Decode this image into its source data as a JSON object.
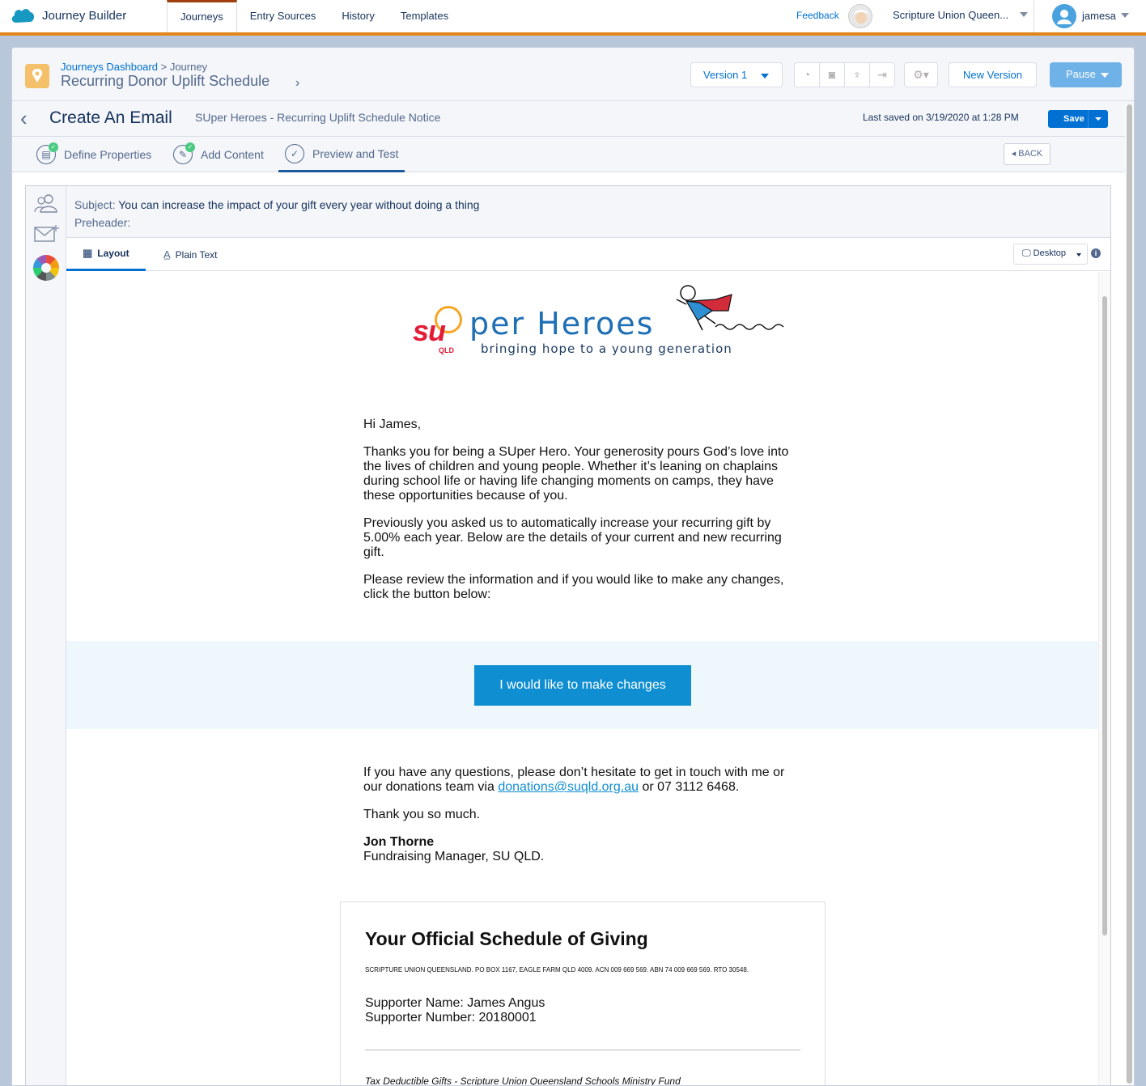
{
  "app": {
    "name": "Journey Builder"
  },
  "nav": {
    "tabs": [
      "Journeys",
      "Entry Sources",
      "History",
      "Templates"
    ],
    "active": "Journeys"
  },
  "top_right": {
    "feedback": "Feedback",
    "org": "Scripture Union Queen...",
    "user": "jamesa"
  },
  "journey": {
    "breadcrumb_root": "Journeys Dashboard",
    "breadcrumb_sep": ">",
    "breadcrumb_current": "Journey",
    "title": "Recurring Donor Uplift Schedule",
    "version": "Version 1",
    "new_version": "New Version",
    "pause": "Pause"
  },
  "email_editor": {
    "title": "Create An Email",
    "email_name": "SUper Heroes - Recurring Uplift Schedule Notice",
    "last_saved": "Last saved on 3/19/2020 at 1:28 PM",
    "save": "Save",
    "steps": [
      "Define Properties",
      "Add Content",
      "Preview and Test"
    ],
    "active_step": "Preview and Test",
    "back": "BACK"
  },
  "preview": {
    "subject_label": "Subject:",
    "subject": "You can increase the impact of your gift every year without doing a thing",
    "preheader_label": "Preheader:",
    "preheader": "",
    "tabs": [
      "Layout",
      "Plain Text"
    ],
    "active_tab": "Layout",
    "device": "Desktop"
  },
  "email": {
    "logo": {
      "su": "su",
      "qld": "QLD",
      "name": "per Heroes",
      "tagline": "bringing hope to a young generation"
    },
    "greeting": "Hi James,",
    "para1": "Thanks you for being a SUper Hero. Your generosity pours God’s love into the lives of children and young people. Whether it’s leaning on chaplains during school life or having life changing moments on camps, they have these opportunities because of you.",
    "para2": "Previously you asked us to automatically increase your recurring gift by 5.00% each year. Below are the details of your current and new recurring gift.",
    "para3": "Please review the information and if you would like to make any changes, click the button below:",
    "cta": "I would like to make changes",
    "questions_a": "If you have any questions, please don’t hesitate to get in touch with me or our donations team via",
    "email_link": "donations@suqld.org.au",
    "questions_b": "or 07 3112 6468.",
    "thanks": "Thank you so much.",
    "signer_name": "Jon Thorne",
    "signer_title": "Fundraising Manager, SU QLD.",
    "schedule": {
      "heading": "Your Official Schedule of Giving",
      "org_line": "SCRIPTURE UNION QUEENSLAND. PO BOX 1167, EAGLE FARM QLD 4009. ACN 009 669 569. ABN 74 009 669 569. RTO 30548.",
      "supporter_name": "Supporter Name: James Angus",
      "supporter_number": "Supporter Number: 20180001",
      "tax_line": "Tax Deductible Gifts - Scripture Union Queensland Schools Ministry Fund"
    }
  },
  "colors": {
    "accent": "#0070d2",
    "brand_orange": "#e0861d",
    "cta": "#0f8fd2"
  }
}
